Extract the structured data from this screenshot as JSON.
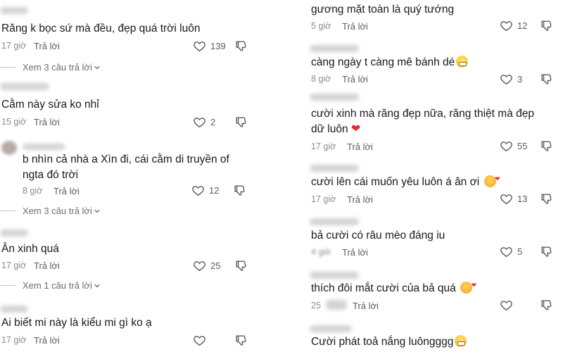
{
  "left": {
    "c1": {
      "text": "Răng k bọc sứ mà đều, đẹp quá trời luôn",
      "time": "17 giờ",
      "reply": "Trả lời",
      "likes": "139"
    },
    "more1": {
      "label": "Xem 3 câu trả lời"
    },
    "c2": {
      "text": "Cằm này sửa ko nhỉ",
      "time": "15 giờ",
      "reply": "Trả lời",
      "likes": "2"
    },
    "c3": {
      "text": "b nhìn cả nhà a Xìn đi, cái cằm di truyền of ngta đó trời",
      "time": "8 giờ",
      "reply": "Trả lời",
      "likes": "12"
    },
    "more2": {
      "label": "Xem 3 câu trả lời"
    },
    "c4": {
      "text": "Ân xinh quá",
      "time": "17 giờ",
      "reply": "Trả lời",
      "likes": "25"
    },
    "more3": {
      "label": "Xem 1 câu trả lời"
    },
    "c5": {
      "text": "Ai biết mi này là kiểu mi gì ko ạ",
      "time": "17 giờ",
      "reply": "Trả lời"
    }
  },
  "right": {
    "c1": {
      "text": "gương mặt toàn là quý tướng",
      "time": "5 giờ",
      "reply": "Trả lời",
      "likes": "12"
    },
    "c2": {
      "text": "càng ngày t càng mê bánh dé",
      "time": "8 giờ",
      "reply": "Trả lời",
      "likes": "3"
    },
    "c3": {
      "text": "cười xinh mà răng đẹp nữa, răng thiệt mà đẹp dữ luôn",
      "time": "17 giờ",
      "reply": "Trả lời",
      "likes": "55"
    },
    "c4": {
      "text": "cười lên cái muốn yêu luôn á ân ơi",
      "time": "17 giờ",
      "reply": "Trả lời",
      "likes": "13"
    },
    "c5": {
      "text": "bả cười có râu mèo đáng iu",
      "time": "4 giờ",
      "reply": "Trả lời",
      "likes": "5"
    },
    "c6": {
      "text": "thích đôi mắt cười của bả quá",
      "time": "25",
      "reply": "Trả lời"
    },
    "c7": {
      "text": "Cười phát toả nắng luôngggg"
    }
  },
  "icons": {
    "like": "heart-outline-icon",
    "dislike": "thumbs-down-icon",
    "chevron": "chevron-down-icon"
  }
}
